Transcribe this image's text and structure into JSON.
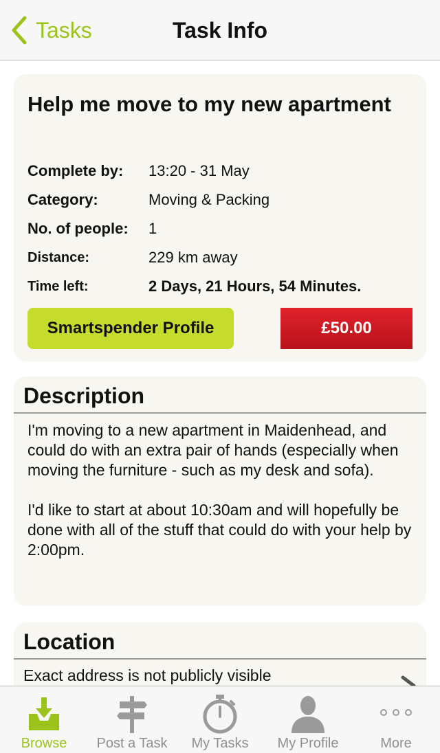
{
  "nav": {
    "back_label": "Tasks",
    "title": "Task Info"
  },
  "task": {
    "title": "Help me move to my new apartment",
    "details": [
      {
        "label": "Complete by:",
        "value": "13:20 - 31 May"
      },
      {
        "label": "Category:",
        "value": "Moving & Packing"
      },
      {
        "label": "No. of people:",
        "value": "1"
      },
      {
        "label": "Distance:",
        "value": "229 km away"
      },
      {
        "label": "Time left:",
        "value": "2 Days, 21 Hours, 54 Minutes."
      }
    ],
    "profile_button": "Smartspender Profile",
    "price_button": "£50.00"
  },
  "description": {
    "heading": "Description",
    "text": "I'm moving to a new apartment in Maidenhead, and could do with an extra pair of hands (especially when moving the furniture - such as my desk and sofa).\n\nI'd like to start at about 10:30am and will hopefully be done with all of the stuff that could do with your help by 2:00pm."
  },
  "location": {
    "heading": "Location",
    "note": "Exact address is not publicly visible"
  },
  "tabs": [
    {
      "label": "Browse",
      "icon": "browse-inbox-icon",
      "active": true
    },
    {
      "label": "Post a Task",
      "icon": "signpost-icon",
      "active": false
    },
    {
      "label": "My Tasks",
      "icon": "stopwatch-icon",
      "active": false
    },
    {
      "label": "My Profile",
      "icon": "person-icon",
      "active": false
    },
    {
      "label": "More",
      "icon": "more-dots-icon",
      "active": false
    }
  ],
  "colors": {
    "accent": "#9cc31b",
    "profile_button": "#c5dc2c",
    "price_button": "#d11a22",
    "card_background": "#f7f6f1"
  }
}
